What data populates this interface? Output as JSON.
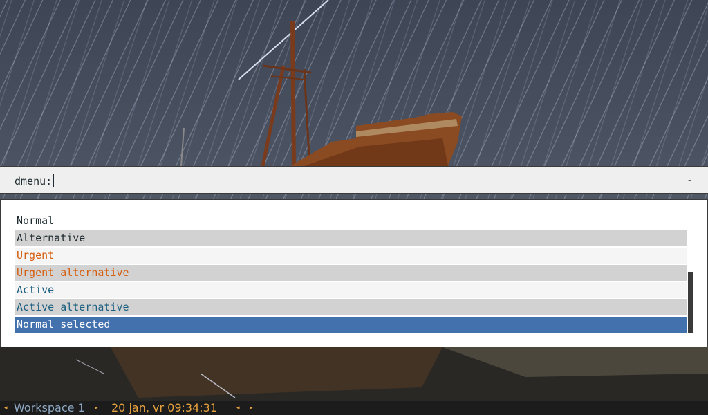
{
  "dmenu": {
    "prompt": "dmenu:",
    "indicator": "-",
    "entries": [
      {
        "label": "Normal",
        "style": "normal"
      },
      {
        "label": "Alternative",
        "style": "alternative"
      },
      {
        "label": "Urgent",
        "style": "urgent"
      },
      {
        "label": "Urgent alternative",
        "style": "urgent-alternative"
      },
      {
        "label": "Active",
        "style": "active"
      },
      {
        "label": "Active alternative",
        "style": "active-alternative"
      },
      {
        "label": "Normal selected",
        "style": "selected"
      }
    ]
  },
  "statusbar": {
    "workspace": "Workspace 1",
    "clock": "20 jan, vr 09:34:31",
    "left_arrow": "◂",
    "right_arrow": "▸"
  },
  "colors": {
    "text_normal": "#1e2b30",
    "text_urgent": "#d65e0f",
    "text_active": "#1c5f80",
    "selected_bg": "#4271ae",
    "alternate_bg": "#d2d2d2",
    "statusbar_bg": "#1c1c1c",
    "statusbar_accent": "#e8a23d",
    "workspace_text": "#8ea8c3"
  }
}
